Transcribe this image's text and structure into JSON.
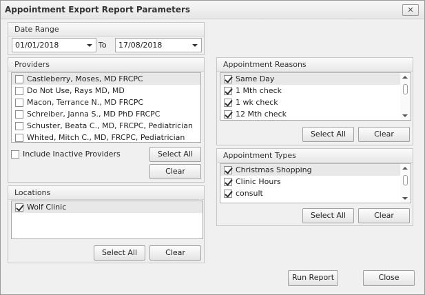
{
  "window": {
    "title": "Appointment Export Report Parameters"
  },
  "date_range": {
    "header": "Date Range",
    "from": "01/01/2018",
    "to_label": "To",
    "to": "17/08/2018"
  },
  "providers": {
    "header": "Providers",
    "items": [
      {
        "label": "Castleberry, Moses, MD FRCPC",
        "checked": false,
        "selected": true
      },
      {
        "label": "Do Not Use, Rays MD, MD",
        "checked": false
      },
      {
        "label": "Macon, Terrance N., MD FRCPC",
        "checked": false
      },
      {
        "label": "Schreiber, Janna S., MD PhD FRCPC",
        "checked": false
      },
      {
        "label": "Schuster, Beata C., MD, FRCPC, Pediatrician",
        "checked": false
      },
      {
        "label": "Whited, Mitch C., MD, FRCPC, Pediatrician",
        "checked": false
      }
    ],
    "include_inactive_label": "Include Inactive Providers",
    "select_all_label": "Select All",
    "clear_label": "Clear"
  },
  "locations": {
    "header": "Locations",
    "items": [
      {
        "label": "Wolf Clinic",
        "checked": true,
        "selected": true
      }
    ],
    "select_all_label": "Select All",
    "clear_label": "Clear"
  },
  "reasons": {
    "header": "Appointment Reasons",
    "items": [
      {
        "label": "Same Day",
        "checked": true,
        "selected": true
      },
      {
        "label": "1 Mth check",
        "checked": true
      },
      {
        "label": "1 wk check",
        "checked": true
      },
      {
        "label": "12 Mth check",
        "checked": true
      }
    ],
    "select_all_label": "Select All",
    "clear_label": "Clear"
  },
  "types": {
    "header": "Appointment Types",
    "items": [
      {
        "label": "Christmas Shopping",
        "checked": true,
        "selected": true
      },
      {
        "label": "Clinic Hours",
        "checked": true
      },
      {
        "label": "consult",
        "checked": true
      }
    ],
    "select_all_label": "Select All",
    "clear_label": "Clear"
  },
  "footer": {
    "run_report_label": "Run Report",
    "close_label": "Close"
  }
}
